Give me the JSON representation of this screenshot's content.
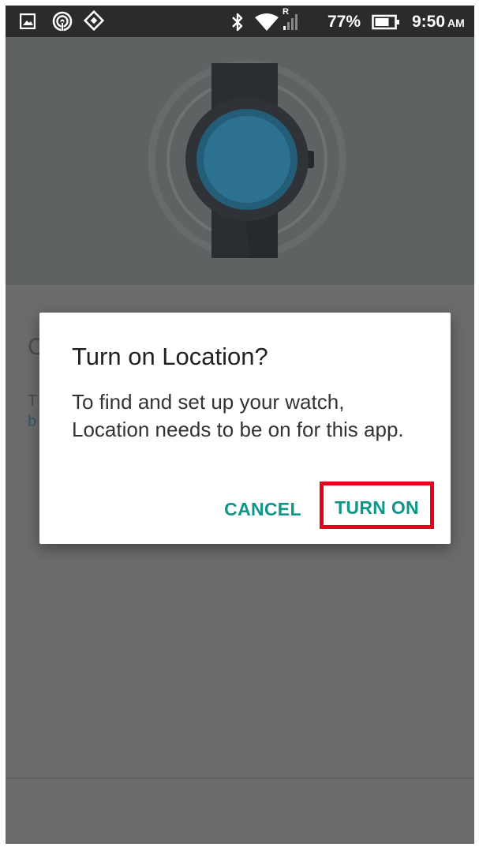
{
  "status_bar": {
    "icons_left": [
      "gallery-icon",
      "hotspot-icon",
      "nav-diamond-icon"
    ],
    "icons_right": [
      "bluetooth-icon",
      "wifi-icon",
      "signal-roaming-icon",
      "battery-icon"
    ],
    "roaming_indicator": "R",
    "battery_percent": "77%",
    "time": "9:50",
    "am_pm": "AM"
  },
  "hero": {
    "illustration": "smartwatch-icon"
  },
  "background": {
    "title_peek": "C",
    "body_peek": "T",
    "link_peek": "b"
  },
  "dialog": {
    "title": "Turn on Location?",
    "message": "To find and set up your watch, Location needs to be on for this app.",
    "cancel_label": "CANCEL",
    "confirm_label": "TURN ON"
  },
  "colors": {
    "accent": "#10958a",
    "highlight_border": "#e8001a",
    "status_bar": "#2b2b2b",
    "scrim": "#6b6b6b"
  }
}
